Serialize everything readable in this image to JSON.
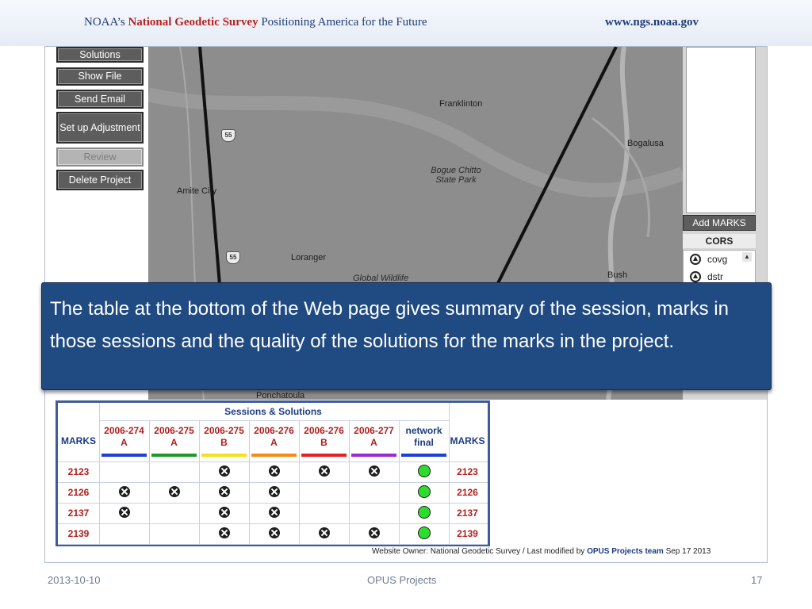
{
  "header": {
    "prefix": "NOAA’s",
    "ngs": "National Geodetic Survey",
    "tagline": "Positioning America for the Future",
    "url": "www.ngs.noaa.gov"
  },
  "buttons": [
    {
      "label": "Solutions"
    },
    {
      "label": "Show File"
    },
    {
      "label": "Send Email"
    },
    {
      "label": "Set up Adjustment"
    },
    {
      "label": "Review"
    },
    {
      "label": "Delete Project"
    }
  ],
  "map": {
    "labels": [
      "Franklinton",
      "Bogalusa",
      "Bogue Chitto State Park",
      "Amite City",
      "Loranger",
      "Global Wildlife",
      "Bush",
      "Ponchatoula"
    ],
    "highways": [
      "55",
      "55"
    ]
  },
  "right_panel": {
    "add_marks": "Add MARKS",
    "cors_header": "CORS",
    "cors_items": [
      "covg",
      "dstr"
    ]
  },
  "table": {
    "title": "Sessions & Solutions",
    "marks_header": "MARKS",
    "sessions": [
      {
        "top": "2006-274",
        "bottom": "A",
        "color": "#1f3fd6"
      },
      {
        "top": "2006-275",
        "bottom": "A",
        "color": "#1f9a2a"
      },
      {
        "top": "2006-275",
        "bottom": "B",
        "color": "#f2e21a"
      },
      {
        "top": "2006-276",
        "bottom": "A",
        "color": "#f38a1a"
      },
      {
        "top": "2006-276",
        "bottom": "B",
        "color": "#e22222"
      },
      {
        "top": "2006-277",
        "bottom": "A",
        "color": "#9a2ad2"
      },
      {
        "top": "network",
        "bottom": "final",
        "color": "#1f3fd6"
      }
    ],
    "rows": [
      {
        "mark": "2123",
        "cells": [
          "",
          "",
          "x",
          "x",
          "x",
          "x",
          "ok"
        ]
      },
      {
        "mark": "2126",
        "cells": [
          "x",
          "x",
          "x",
          "x",
          "",
          "",
          "ok"
        ]
      },
      {
        "mark": "2137",
        "cells": [
          "x",
          "",
          "x",
          "x",
          "",
          "",
          "ok"
        ]
      },
      {
        "mark": "2139",
        "cells": [
          "",
          "",
          "x",
          "x",
          "x",
          "x",
          "ok"
        ]
      }
    ]
  },
  "footer_line": {
    "owner": "Website Owner: National Geodetic Survey",
    "separator": "/",
    "modified": "Last modified by",
    "team": "OPUS Projects team",
    "date": "Sep 17 2013"
  },
  "caption": "The table at the bottom of the Web page gives summary of the session, marks in those sessions and the quality of the solutions for the marks in the project.",
  "slide_footer": {
    "date": "2013-10-10",
    "title": "OPUS Projects",
    "page": "17"
  }
}
